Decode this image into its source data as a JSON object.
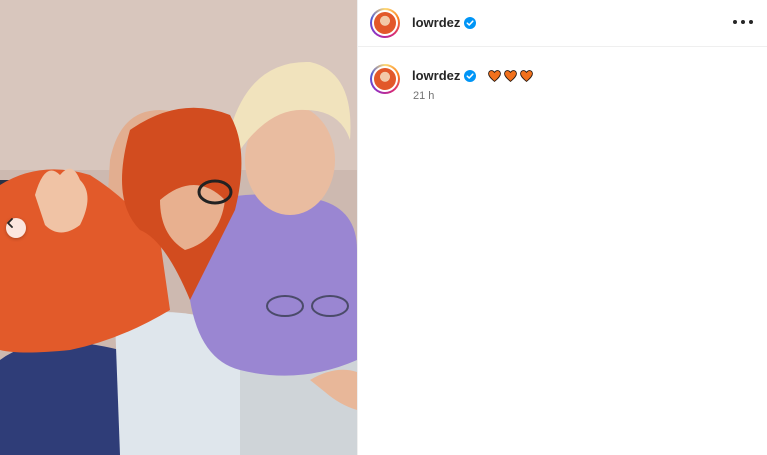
{
  "post": {
    "username": "lowrdez",
    "comment_username": "lowrdez",
    "caption_emoji_names": [
      "orange-heart",
      "orange-heart",
      "orange-heart"
    ],
    "caption_text": "🧡🧡🧡",
    "timestamp": "21 h",
    "accent_verified": "#0095f6",
    "heart_color": "#f2711c"
  },
  "icons": {
    "more": "more-options-icon",
    "verified": "verified-badge-icon",
    "carousel_prev": "chevron-left-icon"
  }
}
